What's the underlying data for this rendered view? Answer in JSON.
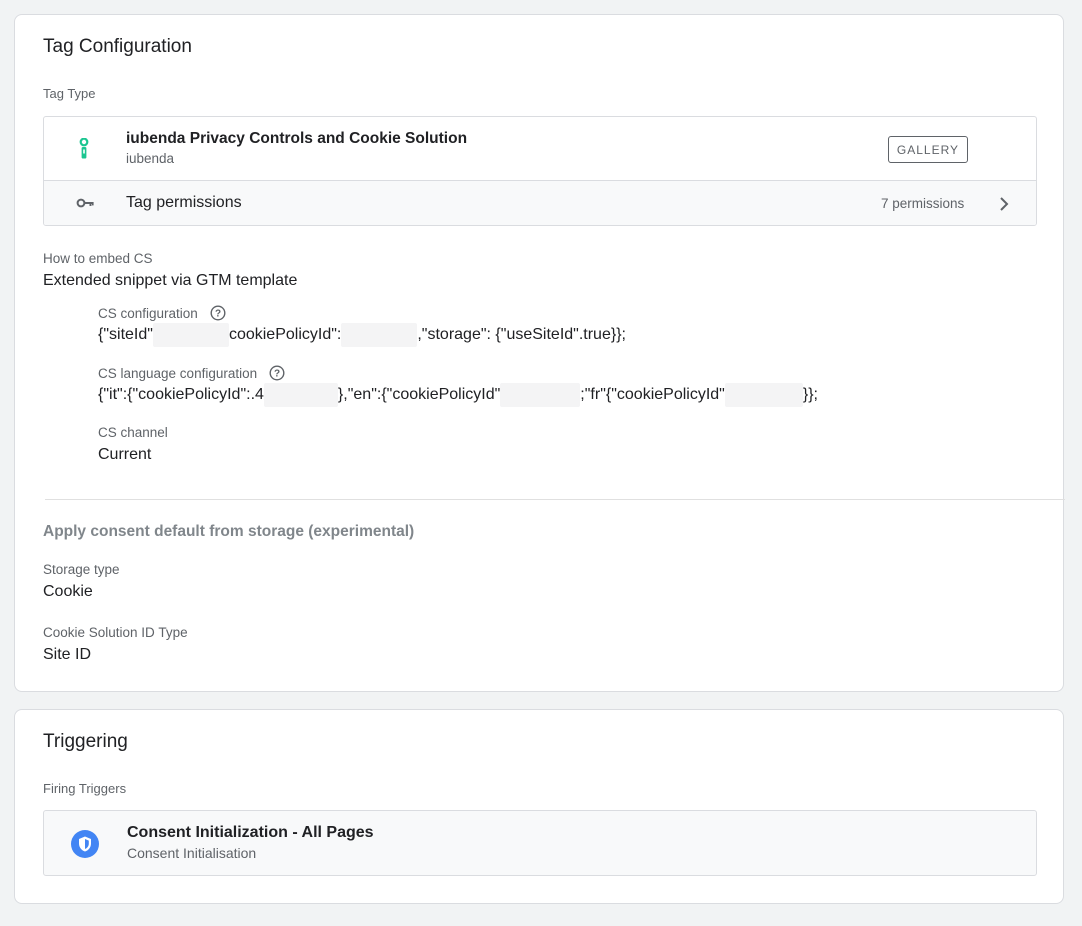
{
  "tag_configuration": {
    "title": "Tag Configuration",
    "tag_type_label": "Tag Type",
    "tag": {
      "name": "iubenda Privacy Controls and Cookie Solution",
      "vendor": "iubenda",
      "icon": "iubenda-logo-icon",
      "gallery_button": "GALLERY"
    },
    "permissions": {
      "label": "Tag permissions",
      "count_text": "7 permissions",
      "icon": "key-icon"
    },
    "embed": {
      "label": "How to embed CS",
      "value": "Extended snippet via GTM template"
    },
    "cs_configuration": {
      "label": "CS configuration",
      "parts": [
        "{\"siteId\"",
        "cookiePolicyId\":",
        ",\"storage\": {\"useSiteId\".true}};"
      ]
    },
    "cs_language_configuration": {
      "label": "CS language configuration",
      "parts": [
        "{\"it\":{\"cookiePolicyId\":.4",
        "},\"en\":{\"cookiePolicyId\"",
        ";\"fr\"{\"cookiePolicyId\"",
        "}};"
      ]
    },
    "cs_channel": {
      "label": "CS channel",
      "value": "Current"
    },
    "consent_heading": "Apply consent default from storage (experimental)",
    "storage_type": {
      "label": "Storage type",
      "value": "Cookie"
    },
    "cookie_solution_id_type": {
      "label": "Cookie Solution ID Type",
      "value": "Site ID"
    }
  },
  "triggering": {
    "title": "Triggering",
    "firing_triggers_label": "Firing Triggers",
    "trigger": {
      "name": "Consent Initialization - All Pages",
      "type": "Consent Initialisation",
      "icon": "shield-icon"
    }
  },
  "colors": {
    "background": "#f1f3f4",
    "iubenda_green": "#1cc691",
    "trigger_blue": "#4285f4"
  }
}
